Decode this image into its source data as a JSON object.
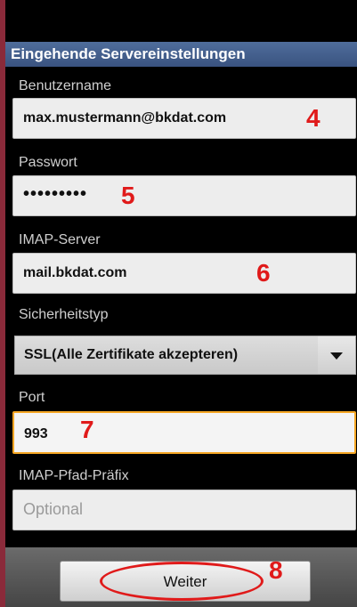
{
  "header": {
    "title": "Eingehende Servereinstellungen"
  },
  "fields": {
    "username": {
      "label": "Benutzername",
      "value": "max.mustermann@bkdat.com",
      "annotation": "4"
    },
    "password": {
      "label": "Passwort",
      "value": "•••••••••",
      "annotation": "5"
    },
    "imap_server": {
      "label": "IMAP-Server",
      "value": "mail.bkdat.com",
      "annotation": "6"
    },
    "security_type": {
      "label": "Sicherheitstyp",
      "value": "SSL(Alle Zertifikate akzepteren)"
    },
    "port": {
      "label": "Port",
      "value": "993",
      "annotation": "7"
    },
    "imap_prefix": {
      "label": "IMAP-Pfad-Präfix",
      "placeholder": "Optional"
    }
  },
  "buttons": {
    "next": {
      "label": "Weiter",
      "annotation": "8"
    }
  },
  "colors": {
    "annotation": "#e01a1a",
    "header": "#3a5380",
    "focus_border": "#f5a623"
  }
}
